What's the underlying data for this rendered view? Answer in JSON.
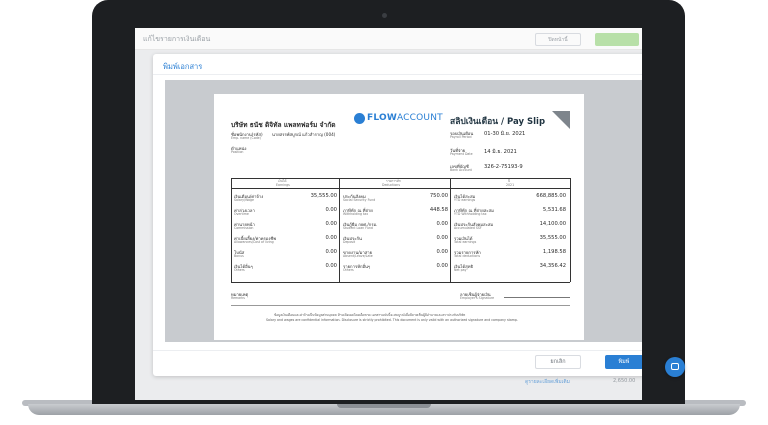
{
  "background_app": {
    "page_title": "แก้ไขรายการเงินเดือน",
    "secondary_button": "ปิดหน้านี้",
    "bottom_link": "ดูรายละเอียดเพิ่มเติม",
    "bottom_amount": "2,650.00"
  },
  "modal": {
    "title": "พิมพ์เอกสาร",
    "close_symbol": "×",
    "cancel_label": "ยกเลิก",
    "print_label": "พิมพ์"
  },
  "payslip": {
    "company_name": "บริษัท ธนัช ดิจิทัล แพลทฟอร์ม จำกัด",
    "logo_flow": "FLOW",
    "logo_account": "ACCOUNT",
    "title": "สลิปเงินเดือน / Pay Slip",
    "employee_label": "ชื่อพนักงาน(รหัส)",
    "employee_label_en": "Emp. name (Code)",
    "employee_value": "นายสรรพ์สบูรณ์ แก้วสำราญ (004)",
    "position_label": "ตำแหน่ง",
    "position_label_en": "Position",
    "period_label": "รอบเงินเดือน",
    "period_label_en": "Payroll Period",
    "period_value": "01-30 มิ.ย. 2021",
    "paydate_label": "วันที่จ่าย",
    "paydate_label_en": "Payment Date",
    "paydate_value": "14 มิ.ย. 2021",
    "bank_label": "เลขที่บัญชี",
    "bank_label_en": "Bank Account",
    "bank_value": "326-2-75193-9",
    "col_earnings": "เงินได้",
    "col_earnings_en": "Earnings",
    "col_deductions": "รายการหัก",
    "col_deductions_en": "Deductions",
    "col_ytd": "ปี",
    "col_ytd_en": "2021",
    "earnings": [
      {
        "th": "เงินเดือน/ค่าจ้าง",
        "en": "Salary/Wage",
        "value": "35,555.00"
      },
      {
        "th": "ค่าล่วงเวลา",
        "en": "Overtime",
        "value": "0.00"
      },
      {
        "th": "ค่านายหน้า",
        "en": "Commission",
        "value": "0.00"
      },
      {
        "th": "ค่าเบี้ยเลี้ยง/ค่าครองชีพ",
        "en": "Allowances/Cost of living",
        "value": "0.00"
      },
      {
        "th": "โบนัส",
        "en": "Bonus",
        "value": "0.00"
      },
      {
        "th": "เงินได้อื่นๆ",
        "en": "Others",
        "value": "0.00"
      }
    ],
    "deductions": [
      {
        "th": "ประกันสังคม",
        "en": "Social Security Fund",
        "value": "750.00"
      },
      {
        "th": "ภาษีหัก ณ ที่จ่าย",
        "en": "Withholding tax",
        "value": "448.58"
      },
      {
        "th": "เงินกู้ยืม กยศ./กรอ.",
        "en": "Student Loan Fund",
        "value": "0.00"
      },
      {
        "th": "เงินประกัน",
        "en": "Deposit",
        "value": "0.00"
      },
      {
        "th": "ขาดงาน/มาสาย",
        "en": "Absent/Leave/Late",
        "value": "0.00"
      },
      {
        "th": "รายการหักอื่นๆ",
        "en": "Others",
        "value": "0.00"
      }
    ],
    "ytd": [
      {
        "th": "เงินได้สะสม",
        "en": "YTD earnings",
        "value": "668,885.00"
      },
      {
        "th": "ภาษีหัก ณ ที่จ่ายสะสม",
        "en": "YTD Withholding tax",
        "value": "5,531.68"
      },
      {
        "th": "เงินประกันสังคมสะสม",
        "en": "Accumulated SSF",
        "value": "14,100.00"
      },
      {
        "th": "รวมเงินได้",
        "en": "Total earnings",
        "value": "35,555.00"
      },
      {
        "th": "รวมรายการหัก",
        "en": "Total deductions",
        "value": "1,198.58"
      },
      {
        "th": "เงินได้สุทธิ",
        "en": "Net pay",
        "value": "34,356.42"
      }
    ],
    "remarks_label": "หมายเหตุ",
    "remarks_label_en": "Remarks",
    "signature_label": "ลายเซ็นผู้จ่ายเงิน",
    "signature_label_en": "Employer's Signature",
    "disclaimer_th": "ข้อมูลเงินเดือนและค่าจ้างเป็นข้อมูลส่วนบุคคล ห้ามเปิดเผยโดยเด็ดขาด เอกสารฉบับนี้จะสมบูรณ์เมื่อมีลายเซ็นผู้มีอำนาจและตราประทับบริษัท",
    "disclaimer_en": "Salary and wages are confidential information. Disclosure is strictly prohibited. This document is only valid with an authorized signature and company stamp."
  },
  "colors": {
    "accent": "#2a7fd4",
    "bezel": "#1d1f22",
    "viewer_bg": "#c8cbcf"
  },
  "icons": {
    "close": "close-icon",
    "chat": "chat-icon",
    "logo": "flowaccount-logo-icon"
  }
}
